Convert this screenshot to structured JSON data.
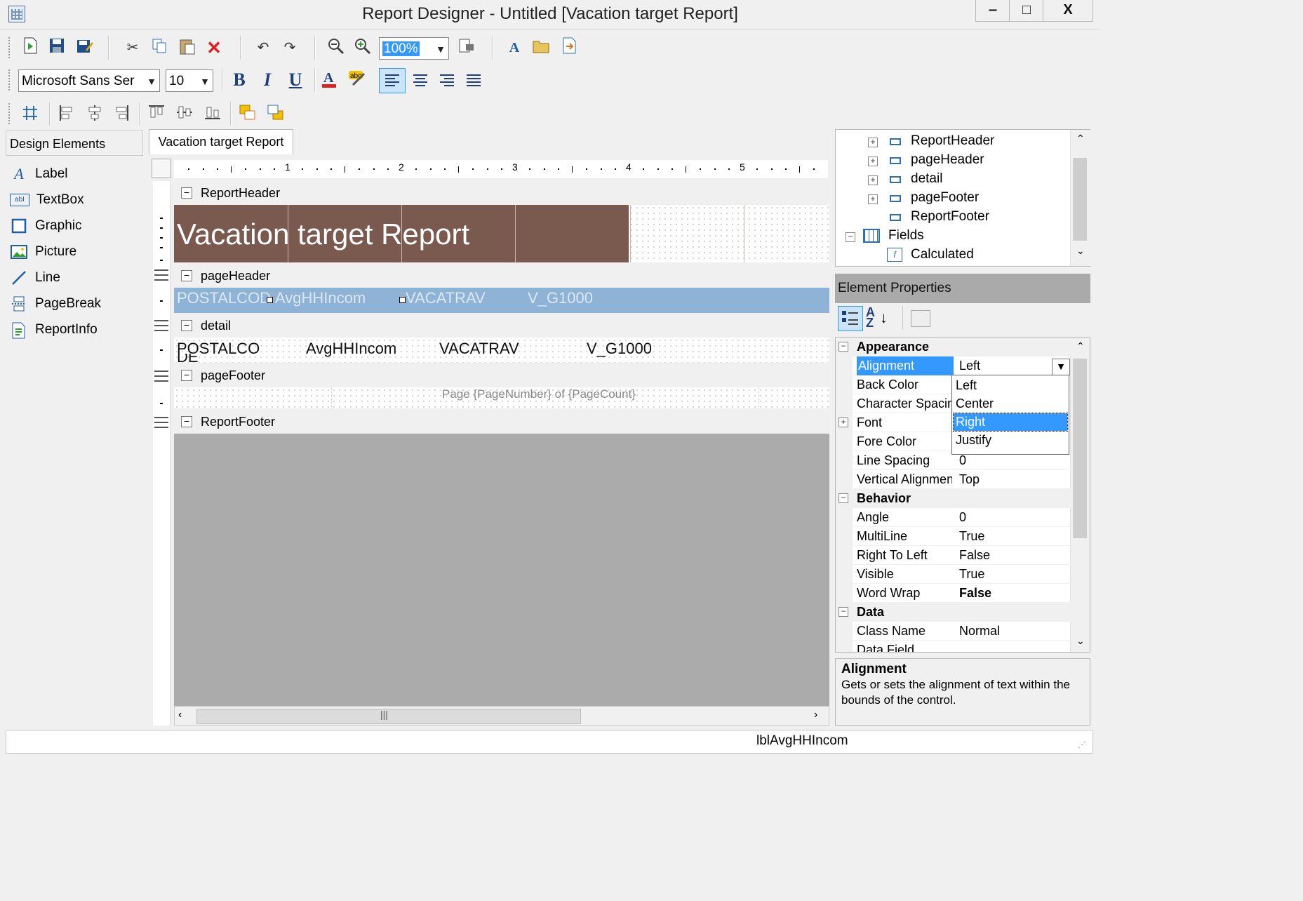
{
  "window": {
    "title": "Report Designer - Untitled [Vacation target Report]",
    "minimize": "‒",
    "maximize": "□",
    "close": "X"
  },
  "toolbar1": {
    "zoom": "100%"
  },
  "toolbar2": {
    "font_name": "Microsoft Sans Ser",
    "font_size": "10",
    "bold": "B",
    "italic": "I",
    "underline": "U"
  },
  "design_elements": {
    "header": "Design Elements",
    "items": [
      {
        "label": "Label",
        "icon": "label-icon"
      },
      {
        "label": "TextBox",
        "icon": "textbox-icon"
      },
      {
        "label": "Graphic",
        "icon": "graphic-icon"
      },
      {
        "label": "Picture",
        "icon": "picture-icon"
      },
      {
        "label": "Line",
        "icon": "line-icon"
      },
      {
        "label": "PageBreak",
        "icon": "pagebreak-icon"
      },
      {
        "label": "ReportInfo",
        "icon": "reportinfo-icon"
      }
    ]
  },
  "tab": {
    "active": "Vacation target Report"
  },
  "ruler": {
    "numbers": [
      "1",
      "2",
      "3",
      "4",
      "5"
    ]
  },
  "sections": {
    "report_header": "ReportHeader",
    "page_header": "pageHeader",
    "detail": "detail",
    "page_footer": "pageFooter",
    "report_footer": "ReportFooter"
  },
  "report": {
    "title": "Vacation target Report",
    "page_header_fields": [
      "POSTALCOD",
      "AvgHHIncom",
      "VACATRAV",
      "V_G1000"
    ],
    "detail_fields": [
      "POSTALCO",
      "AvgHHIncom",
      "VACATRAV",
      "V_G1000"
    ],
    "detail_overflow": "DE",
    "page_footer_text": "Page {PageNumber} of {PageCount}"
  },
  "tree": {
    "nodes": [
      "ReportHeader",
      "pageHeader",
      "detail",
      "pageFooter",
      "ReportFooter",
      "Fields",
      "Calculated"
    ]
  },
  "properties": {
    "header": "Element Properties",
    "categories": {
      "appearance": "Appearance",
      "behavior": "Behavior",
      "data": "Data"
    },
    "rows": {
      "alignment": {
        "name": "Alignment",
        "value": "Left"
      },
      "back_color": {
        "name": "Back Color",
        "value": ""
      },
      "char_spacing": {
        "name": "Character Spacing",
        "value": ""
      },
      "font": {
        "name": "Font",
        "value": ""
      },
      "fore_color": {
        "name": "Fore Color",
        "value": ""
      },
      "line_spacing": {
        "name": "Line Spacing",
        "value": "0"
      },
      "vertical_alignment": {
        "name": "Vertical Alignment",
        "value": "Top"
      },
      "angle": {
        "name": "Angle",
        "value": "0"
      },
      "multiline": {
        "name": "MultiLine",
        "value": "True"
      },
      "right_to_left": {
        "name": "Right To Left",
        "value": "False"
      },
      "visible": {
        "name": "Visible",
        "value": "True"
      },
      "word_wrap": {
        "name": "Word Wrap",
        "value": "False"
      },
      "class_name": {
        "name": "Class Name",
        "value": "Normal"
      },
      "data_field": {
        "name": "Data Field",
        "value": ""
      }
    },
    "dropdown_options": [
      "Left",
      "Center",
      "Right",
      "Justify"
    ],
    "dropdown_selected": "Right",
    "description_title": "Alignment",
    "description_text": "Gets or sets the alignment of text within the bounds of the control."
  },
  "status": {
    "text": "lblAvgHHIncom"
  },
  "colors": {
    "report_title_band": "#7a5a4e",
    "page_header_band": "#8fb3d6",
    "selection": "#3399ff",
    "footer_area": "#ababab"
  }
}
